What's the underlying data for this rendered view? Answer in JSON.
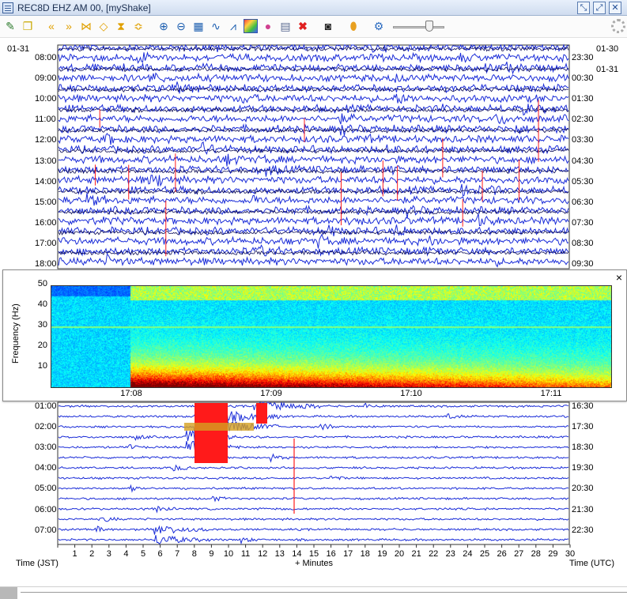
{
  "window": {
    "title": "REC8D EHZ AM 00, [myShake]"
  },
  "colors": {
    "trace_blue": "#1a2cd8",
    "trace_dark": "#0b0b55",
    "highlight_red": "#ff1a1a",
    "spectro_low": "#0b2aa8",
    "spectro_high": "#a80000"
  },
  "toolbar": {
    "icons": [
      "edit-icon",
      "copy-icon",
      "rewind-fast-icon",
      "forward-fast-icon",
      "collapse-icon",
      "expand-icon",
      "filter-icon",
      "layers-icon",
      "zoom-in-icon",
      "zoom-out-icon",
      "table-icon",
      "waveform-icon",
      "spectrum-icon",
      "spectrogram-icon",
      "palette-icon",
      "clipboard-icon",
      "delete-icon",
      "camera-icon",
      "tag-icon",
      "gear-config-icon",
      "settings-icon"
    ]
  },
  "helicorder": {
    "date_left": "01-31",
    "date_right_top": "01-30",
    "date_right_second": "01-31",
    "left_hours_top": [
      "08:00",
      "09:00",
      "10:00",
      "11:00",
      "12:00",
      "13:00",
      "14:00",
      "15:00",
      "16:00",
      "17:00",
      "18:00"
    ],
    "right_hours_top": [
      "23:30",
      "00:30",
      "01:30",
      "02:30",
      "03:30",
      "04:30",
      "05:30",
      "06:30",
      "07:30",
      "08:30",
      "09:30"
    ],
    "left_hours_bottom": [
      "01:00",
      "02:00",
      "03:00",
      "04:00",
      "05:00",
      "06:00",
      "07:00"
    ],
    "right_hours_bottom": [
      "16:30",
      "17:30",
      "18:30",
      "19:30",
      "20:30",
      "21:30",
      "22:30"
    ],
    "minute_ticks": [
      "1",
      "2",
      "3",
      "4",
      "5",
      "6",
      "7",
      "8",
      "9",
      "10",
      "11",
      "12",
      "13",
      "14",
      "15",
      "16",
      "17",
      "18",
      "19",
      "20",
      "21",
      "22",
      "23",
      "24",
      "25",
      "26",
      "27",
      "28",
      "29",
      "30"
    ],
    "x_label": "+ Minutes",
    "left_label": "Time (JST)",
    "right_label": "Time (UTC)"
  },
  "spectrogram": {
    "close_label": "×",
    "y_label": "Frequency (Hz)",
    "freq_ticks": [
      "50",
      "40",
      "30",
      "20",
      "10"
    ],
    "time_ticks": [
      "17:08",
      "17:09",
      "17:10",
      "17:11"
    ]
  }
}
